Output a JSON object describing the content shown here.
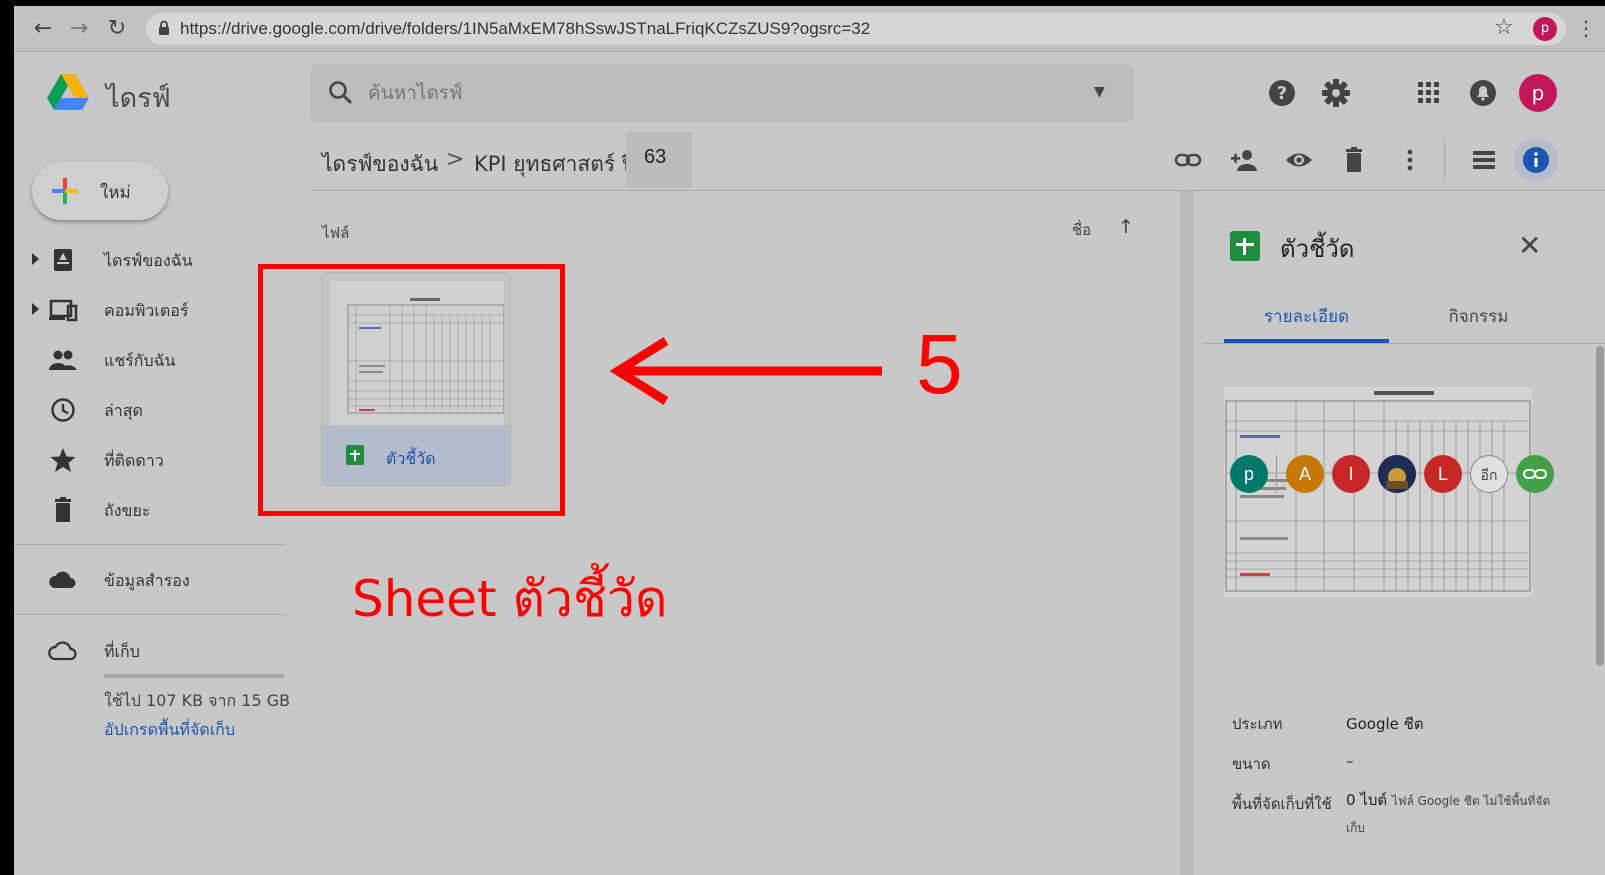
{
  "browser": {
    "url": "https://drive.google.com/drive/folders/1IN5aMxEM78hSswJSTnaLFriqKCZsZUS9?ogsrc=32",
    "profile_initial": "p"
  },
  "app": {
    "name": "ไดรฟ์",
    "search_placeholder": "ค้นหาไดรฟ์",
    "account_initial": "p"
  },
  "sidebar": {
    "new_label": "ใหม่",
    "items": [
      {
        "label": "ไดรฟ์ของฉัน",
        "icon": "my-drive-icon"
      },
      {
        "label": "คอมพิวเตอร์",
        "icon": "computers-icon"
      },
      {
        "label": "แชร์กับฉัน",
        "icon": "shared-icon"
      },
      {
        "label": "ล่าสุด",
        "icon": "clock-icon"
      },
      {
        "label": "ที่ติดดาว",
        "icon": "star-icon"
      },
      {
        "label": "ถังขยะ",
        "icon": "trash-icon"
      },
      {
        "label": "ข้อมูลสำรอง",
        "icon": "cloud-icon"
      },
      {
        "label": "ที่เก็บ",
        "icon": "cloud-outline-icon"
      }
    ],
    "storage_used": "ใช้ไป 107 KB จาก 15 GB",
    "storage_fraction": 0.0,
    "upgrade_link": "อัปเกรดพื้นที่จัดเก็บ"
  },
  "breadcrumb": {
    "root": "ไดรฟ์ของฉัน",
    "separator": ">",
    "folder": "KPI ยุทธศาสตร์ ปี",
    "folder_suffix": "63"
  },
  "file_area": {
    "section_label": "ไฟล์",
    "sort_label": "ชื่อ",
    "sort_direction": "↑",
    "files": [
      {
        "name": "ตัวชี้วัด",
        "type": "sheet"
      }
    ]
  },
  "annotation": {
    "step_number": "5",
    "caption": "Sheet ตัวชี้วัด",
    "color": "#ff0000"
  },
  "details": {
    "title": "ตัวชี้วัด",
    "tabs": [
      "รายละเอียด",
      "กิจกรรม"
    ],
    "active_tab": "รายละเอียด",
    "share_avatars": [
      {
        "initial": "p",
        "color": "#00796b"
      },
      {
        "initial": "A",
        "color": "#c67800"
      },
      {
        "initial": "I",
        "color": "#c62828"
      },
      {
        "initial": "",
        "color": "#2a3a6a"
      },
      {
        "initial": "L",
        "color": "#c62828"
      },
      {
        "initial": "อีก",
        "color": "#e0e0e0"
      },
      {
        "initial": "",
        "color": "#43a047"
      }
    ],
    "props": [
      {
        "label": "ประเภท",
        "value": "Google ชีต",
        "note": ""
      },
      {
        "label": "ขนาด",
        "value": "–",
        "note": ""
      },
      {
        "label": "พื้นที่จัดเก็บที่ใช้",
        "value": "0 ไบต์",
        "note": "ไฟล์ Google ชีต ไม่ใช้พื้นที่จัดเก็บ"
      }
    ]
  },
  "colors": {
    "accent_blue": "#1a55b0",
    "sheets_green": "#1e8e3e",
    "highlight_red": "#ff0000"
  }
}
